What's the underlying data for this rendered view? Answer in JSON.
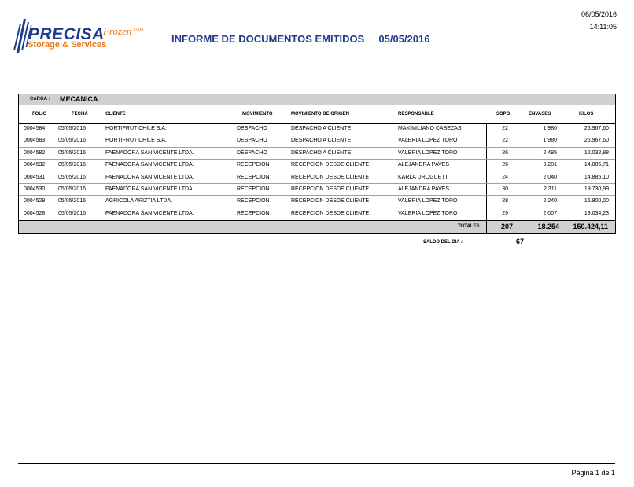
{
  "logo": {
    "word": "PRECISA",
    "frozen": "Frozen",
    "tm": "LTDA",
    "sub": "Storage & Services"
  },
  "header": {
    "title": "INFORME DE DOCUMENTOS EMITIDOS",
    "title_date": "05/05/2016",
    "print_date": "06/05/2016",
    "print_time": "14:11:05"
  },
  "carga": {
    "label": "CARGA :",
    "value": "MECANICA"
  },
  "columns": [
    "FOLIO",
    "FECHA",
    "CLIENTE",
    "MOVIMIENTO",
    "MOVIMIENTO DE ORIGEN",
    "RESPONSABLE",
    "SOPO.",
    "ENVASES",
    "KILOS"
  ],
  "rows": [
    [
      "0004584",
      "05/05/2016",
      "HORTIFRUT CHILE S.A.",
      "DESPACHO",
      "DESPACHO A CLIENTE",
      "MAXIMILIANO CABEZAS",
      "22",
      "1.980",
      "26.967,60"
    ],
    [
      "0004583",
      "05/05/2016",
      "HORTIFRUT CHILE S.A.",
      "DESPACHO",
      "DESPACHO A CLIENTE",
      "VALERIA LOPEZ TORO",
      "22",
      "1.980",
      "26.967,60"
    ],
    [
      "0004582",
      "05/05/2016",
      "FAENADORA SAN VICENTE LTDA.",
      "DESPACHO",
      "DESPACHO A CLIENTE",
      "VALERIA LOPEZ TORO",
      "26",
      "2.495",
      "12.032,88"
    ],
    [
      "0004532",
      "05/05/2016",
      "FAENADORA SAN VICENTE LTDA.",
      "RECEPCION",
      "RECEPCION DESDE CLIENTE",
      "ALEJANDRA  PAVES",
      "26",
      "3.201",
      "14.005,71"
    ],
    [
      "0004531",
      "05/05/2016",
      "FAENADORA SAN VICENTE LTDA.",
      "RECEPCION",
      "RECEPCION DESDE CLIENTE",
      "KARLA DROGUETT",
      "24",
      "2.040",
      "14.885,10"
    ],
    [
      "0004530",
      "05/05/2016",
      "FAENADORA SAN VICENTE LTDA.",
      "RECEPCION",
      "RECEPCION DESDE CLIENTE",
      "ALEJANDRA  PAVES",
      "30",
      "2.311",
      "19.730,99"
    ],
    [
      "0004529",
      "05/05/2016",
      "AGRICOLA ARIZTIA LTDA.",
      "RECEPCION",
      "RECEPCION DESDE CLIENTE",
      "VALERIA LOPEZ TORO",
      "28",
      "2.240",
      "16.800,00"
    ],
    [
      "0004528",
      "05/05/2016",
      "FAENADORA SAN VICENTE LTDA.",
      "RECEPCION",
      "RECEPCION DESDE CLIENTE",
      "VALERIA LOPEZ TORO",
      "29",
      "2.007",
      "19.034,23"
    ]
  ],
  "totals": {
    "label": "TOTALES",
    "sopo": "207",
    "envases": "18.254",
    "kilos": "150.424,11"
  },
  "saldo": {
    "label": "SALDO DEL DIA :",
    "value": "67"
  },
  "footer": {
    "page": "Página 1 de 1"
  }
}
